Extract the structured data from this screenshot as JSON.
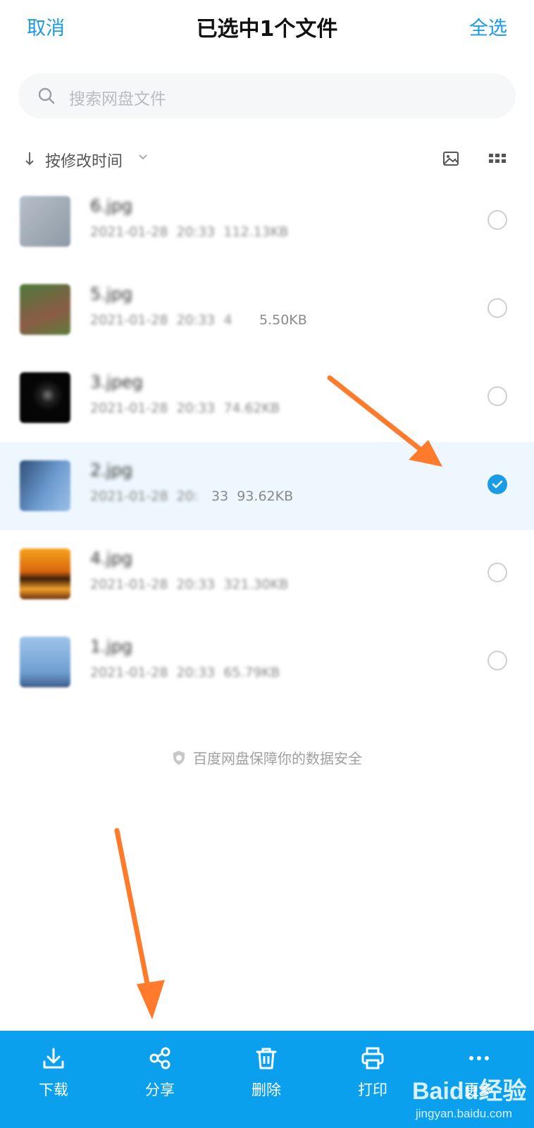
{
  "header": {
    "cancel": "取消",
    "title": "已选中1个文件",
    "select_all": "全选"
  },
  "search": {
    "placeholder": "搜索网盘文件"
  },
  "sort": {
    "label": "按修改时间"
  },
  "files": [
    {
      "name": "6.jpg",
      "meta": "2021-01-28  20:33  112.13KB",
      "selected": false
    },
    {
      "name": "5.jpg",
      "meta": "2021-01-28  20:33  4",
      "meta_clear": "5.50KB",
      "selected": false
    },
    {
      "name": "3.jpeg",
      "meta": "2021-01-28  20:33  74.62KB",
      "selected": false
    },
    {
      "name": "2.jpg",
      "meta": "2021-01-28  20:",
      "meta_clear": "33  93.62KB",
      "selected": true
    },
    {
      "name": "4.jpg",
      "meta": "2021-01-28  20:33  321.30KB",
      "selected": false
    },
    {
      "name": "1.jpg",
      "meta": "2021-01-28  20:33  65.79KB",
      "selected": false
    }
  ],
  "footer_note": "百度网盘保障你的数据安全",
  "toolbar": {
    "download": "下载",
    "share": "分享",
    "delete": "删除",
    "print": "打印",
    "more": "更多"
  },
  "watermark": {
    "logo": "Baidu经验",
    "url": "jingyan.baidu.com"
  },
  "colors": {
    "accent": "#1a9be6",
    "toolbar": "#0aa0ee",
    "arrow": "#ff7a2b",
    "selected_row": "#edf7fd"
  }
}
